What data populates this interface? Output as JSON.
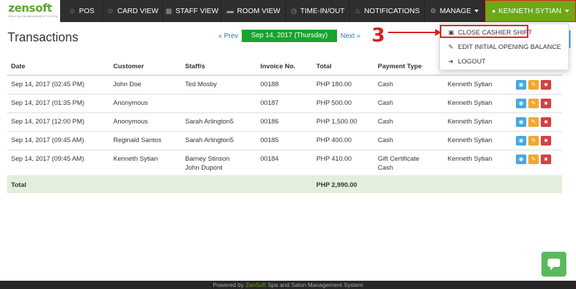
{
  "brand": {
    "name": "zensoft",
    "tagline": "SPA & SALON MANAGEMENT SYSTEM"
  },
  "nav": {
    "items": [
      {
        "label": "POS",
        "icon": "users-icon"
      },
      {
        "label": "CARD VIEW",
        "icon": "users-icon"
      },
      {
        "label": "STAFF VIEW",
        "icon": "sitemap-icon"
      },
      {
        "label": "ROOM VIEW",
        "icon": "bed-icon"
      },
      {
        "label": "TIME-IN/OUT",
        "icon": "clock-icon"
      },
      {
        "label": "NOTIFICATIONS",
        "icon": "bell-icon"
      },
      {
        "label": "MANAGE",
        "icon": "gear-icon"
      }
    ],
    "user": "KENNETH SYTIAN"
  },
  "page": {
    "title": "Transactions",
    "prev": "« Prev",
    "date": "Sep 14, 2017 (Thursday)",
    "next": "Next »"
  },
  "table": {
    "headers": [
      "Date",
      "Customer",
      "Staff/s",
      "Invoice No.",
      "Total",
      "Payment Type"
    ],
    "rows": [
      {
        "date": "Sep 14, 2017 (02:45 PM)",
        "customer": "John Doe",
        "staff": "Ted Mosby",
        "staff2": "",
        "invoice": "00188",
        "total": "PHP 180.00",
        "payment": "Cash",
        "payment2": "",
        "cashier": "Kenneth Sytian"
      },
      {
        "date": "Sep 14, 2017 (01:35 PM)",
        "customer": "Anonymous",
        "staff": "",
        "staff2": "",
        "invoice": "00187",
        "total": "PHP 500.00",
        "payment": "Cash",
        "payment2": "",
        "cashier": "Kenneth Sytian"
      },
      {
        "date": "Sep 14, 2017 (12:00 PM)",
        "customer": "Anonymous",
        "staff": "Sarah Arlington5",
        "staff2": "",
        "invoice": "00186",
        "total": "PHP 1,500.00",
        "payment": "Cash",
        "payment2": "",
        "cashier": "Kenneth Sytian"
      },
      {
        "date": "Sep 14, 2017 (09:45 AM)",
        "customer": "Reginald Santos",
        "staff": "Sarah Arlington5",
        "staff2": "",
        "invoice": "00185",
        "total": "PHP 400.00",
        "payment": "Cash",
        "payment2": "",
        "cashier": "Kenneth Sytian"
      },
      {
        "date": "Sep 14, 2017 (09:45 AM)",
        "customer": "Kenneth Sytian",
        "staff": "Barney Stinson",
        "staff2": "John Dupont",
        "invoice": "00184",
        "total": "PHP 410.00",
        "payment": "Gift Certificate",
        "payment2": "Cash",
        "cashier": "Kenneth Sytian"
      }
    ],
    "total_label": "Total",
    "total_value": "PHP 2,990.00"
  },
  "dropdown": {
    "items": [
      {
        "label": "CLOSE CASHIER SHIFT",
        "icon": "money-icon"
      },
      {
        "label": "EDIT INITIAL OPENING BALANCE",
        "icon": "edit-icon"
      },
      {
        "label": "LOGOUT",
        "icon": "sign-out-icon"
      }
    ]
  },
  "annotation": {
    "step": "3",
    "color": "#d81f1f"
  },
  "footer": {
    "prefix": "Powered by ",
    "brand": "ZenSoft",
    "suffix": " Spa and Salon Management System"
  },
  "colors": {
    "accent": "#6ea816",
    "navbar": "#2f2f2f",
    "date_badge": "#1aa32e",
    "total_row": "#e3efdc"
  }
}
